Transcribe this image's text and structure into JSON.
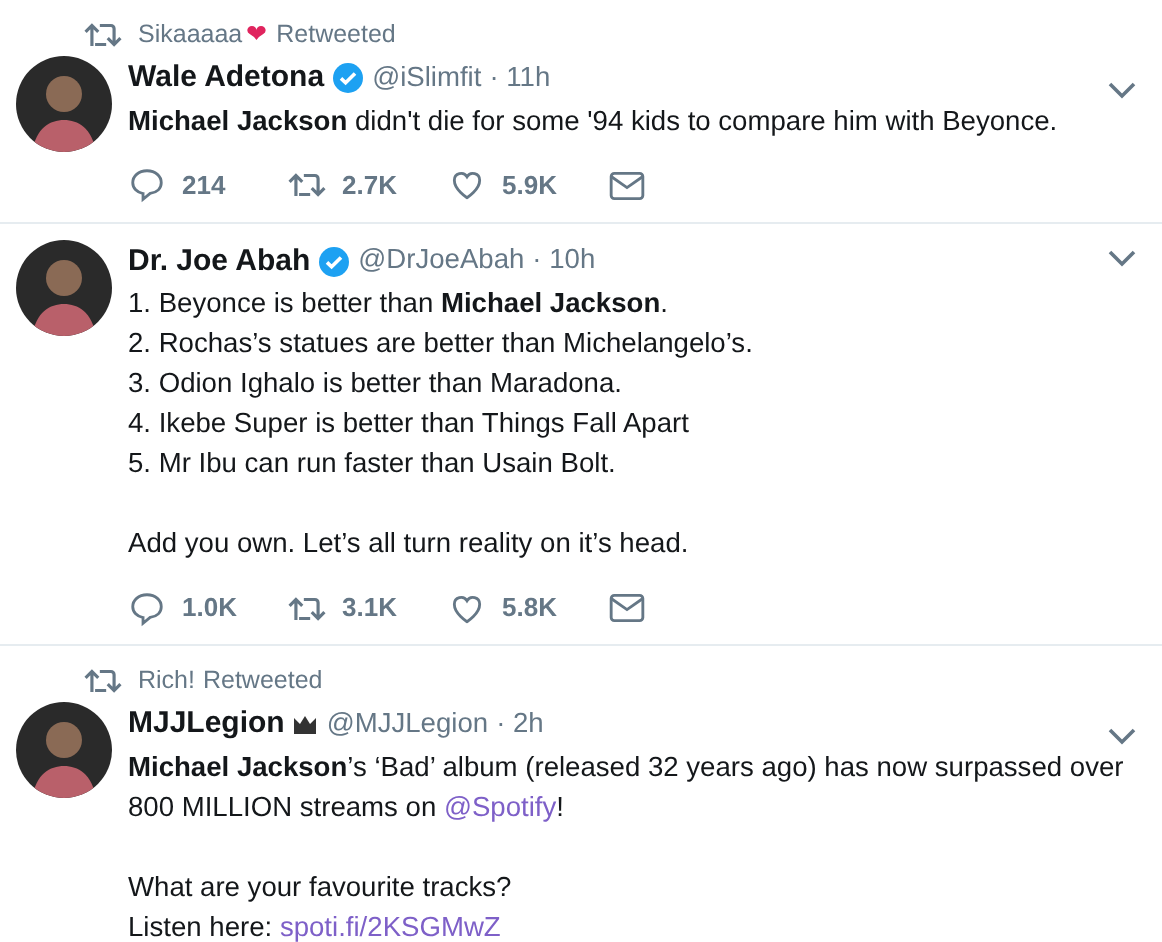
{
  "tweets": [
    {
      "retweeted_by": {
        "name": "Sikaaaaa",
        "emoji": "❤",
        "suffix": "Retweeted"
      },
      "name": "Wale Adetona",
      "badge": {
        "kind": "verified"
      },
      "handle": "@iSlimfit",
      "time": "· 11h",
      "blocks": [
        [
          [
            {
              "text": "**Michael Jackson** didn't die for some '94 kids to compare him with Beyonce."
            }
          ]
        ]
      ],
      "actions": {
        "replies": "214",
        "retweets": "2.7K",
        "likes": "5.9K"
      }
    },
    {
      "name": "Dr. Joe Abah",
      "badge": {
        "kind": "verified"
      },
      "handle": "@DrJoeAbah",
      "time": "· 10h",
      "blocks": [
        [
          [
            {
              "text": "1. Beyonce is better than **Michael Jackson**."
            }
          ],
          [
            {
              "text": "2. Rochas’s statues are better than Michelangelo’s."
            }
          ],
          [
            {
              "text": "3. Odion Ighalo is better than Maradona."
            }
          ],
          [
            {
              "text": "4. Ikebe Super is better than Things Fall Apart"
            }
          ],
          [
            {
              "text": "5. Mr Ibu can run faster than Usain Bolt."
            }
          ]
        ],
        [
          [
            {
              "text": "Add you own. Let’s all turn reality on it’s head."
            }
          ]
        ]
      ],
      "actions": {
        "replies": "1.0K",
        "retweets": "3.1K",
        "likes": "5.8K"
      }
    },
    {
      "retweeted_by": {
        "name": "Rich!",
        "suffix": "Retweeted"
      },
      "name": "MJJLegion",
      "badge": {
        "kind": "crown"
      },
      "handle": "@MJJLegion",
      "time": "· 2h",
      "blocks": [
        [
          [
            {
              "text": "**Michael Jackson**’s ‘Bad’ album (released 32 years ago) has now surpassed over 800 MILLION streams on "
            },
            {
              "text": "@Spotify",
              "kind": "link"
            },
            {
              "text": "!"
            }
          ]
        ],
        [
          [
            {
              "text": "What are your favourite tracks?"
            }
          ],
          [
            {
              "text": "Listen here: "
            },
            {
              "text": "spoti.fi/2KSGMwZ",
              "kind": "link"
            }
          ]
        ]
      ]
    }
  ]
}
